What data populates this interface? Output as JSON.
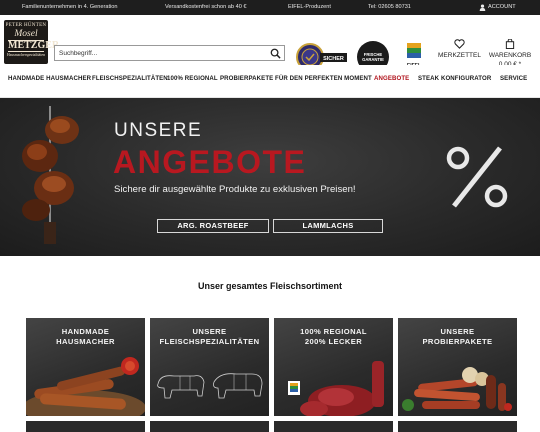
{
  "topbar": {
    "generation": "Familienunternehmen in 4. Generation",
    "shipping": "Versandkostenfrei schon ab 40 €",
    "eifel": "EIFEL-Produzent",
    "phone": "Tel: 02605 80731",
    "account": "ACCOUNT"
  },
  "logo": {
    "line1": "PETER HÜNTEN",
    "line2": "Mosel",
    "line3": "METZGER",
    "line4": "Hausmacherspezialitäten"
  },
  "search": {
    "placeholder": "Suchbegriff..."
  },
  "badges": {
    "sicher": "SICHER",
    "frische": "FRISCHE GARANTIE",
    "eifel": "EIFEL"
  },
  "header": {
    "wishlist": "MERKZETTEL",
    "cart": "WARENKORB",
    "cart_total": "0,00 € *"
  },
  "nav": {
    "items": [
      "HANDMADE HAUSMACHER",
      "FLEISCHSPEZIALITÄTEN",
      "100% REGIONAL",
      "PROBIERPAKETE",
      "FÜR DEN PERFEKTEN MOMENT",
      "ANGEBOTE",
      "STEAK KONFIGURATOR",
      "SERVICE"
    ],
    "active_color": "#b0121b"
  },
  "hero": {
    "title1": "UNSERE",
    "title2": "ANGEBOTE",
    "subtitle": "Sichere dir ausgewählte Produkte zu exklusiven Preisen!",
    "button1": "ARG. ROASTBEEF",
    "button2": "LAMMLACHS",
    "accent_color": "#b81820"
  },
  "section": {
    "title": "Unser gesamtes Fleischsortiment"
  },
  "categories": [
    {
      "line1": "HANDMADE",
      "line2": "HAUSMACHER"
    },
    {
      "line1": "UNSERE",
      "line2": "FLEISCHSPEZIALITÄTEN"
    },
    {
      "line1": "100% REGIONAL",
      "line2": "200% LECKER"
    },
    {
      "line1": "UNSERE",
      "line2": "PROBIERPAKETE"
    }
  ]
}
